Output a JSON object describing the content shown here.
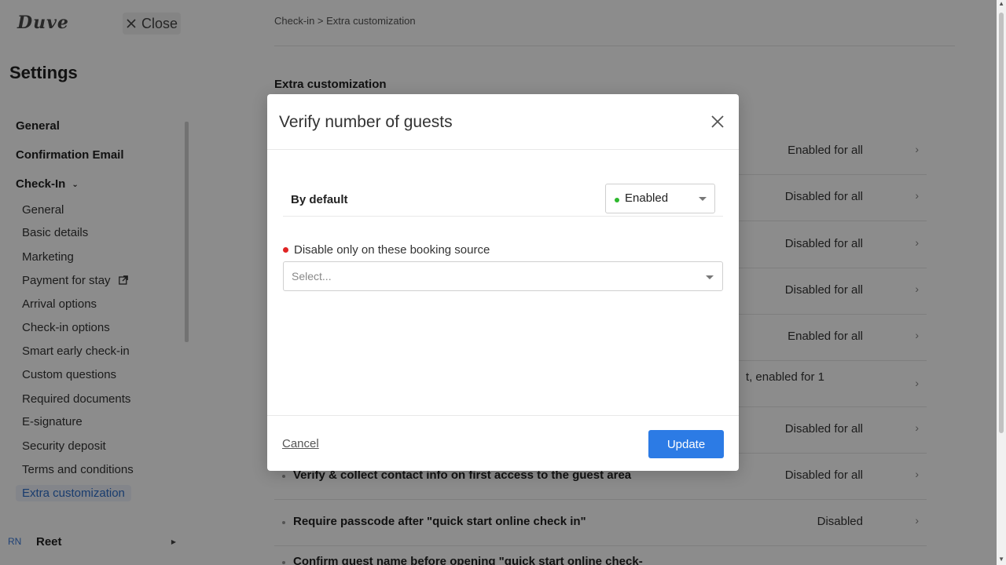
{
  "sidebar": {
    "logo": "Duve",
    "close_label": "Close",
    "title": "Settings",
    "top_items": [
      {
        "label": "General"
      },
      {
        "label": "Confirmation Email"
      },
      {
        "label": "Check-In"
      }
    ],
    "sub_items": [
      {
        "label": "General"
      },
      {
        "label": "Basic details"
      },
      {
        "label": "Marketing"
      },
      {
        "label": "Payment for stay"
      },
      {
        "label": "Arrival options"
      },
      {
        "label": "Check-in options"
      },
      {
        "label": "Smart early check-in"
      },
      {
        "label": "Custom questions"
      },
      {
        "label": "Required documents"
      },
      {
        "label": "E-signature"
      },
      {
        "label": "Security deposit"
      },
      {
        "label": "Terms and conditions"
      },
      {
        "label": "Extra customization"
      }
    ],
    "user": {
      "initials": "RN",
      "name": "Reet"
    }
  },
  "main": {
    "breadcrumb": "Check-in > Extra customization",
    "section_title": "Extra customization",
    "rows": [
      {
        "label": "",
        "status": "Enabled for all"
      },
      {
        "label": "",
        "status": "Disabled for all"
      },
      {
        "label": "",
        "status": "Disabled for all"
      },
      {
        "label": "",
        "status": "Disabled for all"
      },
      {
        "label": "",
        "status": "Enabled for all"
      },
      {
        "label": "",
        "status": "t, enabled for 1"
      },
      {
        "label": "",
        "status": "Disabled for all"
      },
      {
        "label": "Verify & collect contact info on first access to the guest area",
        "status": "Disabled for all"
      },
      {
        "label": "Require passcode after \"quick start online check in\"",
        "status": "Disabled"
      },
      {
        "label": "Confirm guest name before opening \"quick start online check-",
        "status": ""
      }
    ]
  },
  "modal": {
    "title": "Verify number of guests",
    "default_label": "By default",
    "default_value": "Enabled",
    "source_label": "Disable only on these booking source",
    "source_placeholder": "Select...",
    "cancel_label": "Cancel",
    "update_label": "Update"
  },
  "colors": {
    "accent": "#2c7be5",
    "enabled_dot": "#2eb82e",
    "required_dot": "#e02424",
    "active_nav": "#2f6ec8"
  }
}
